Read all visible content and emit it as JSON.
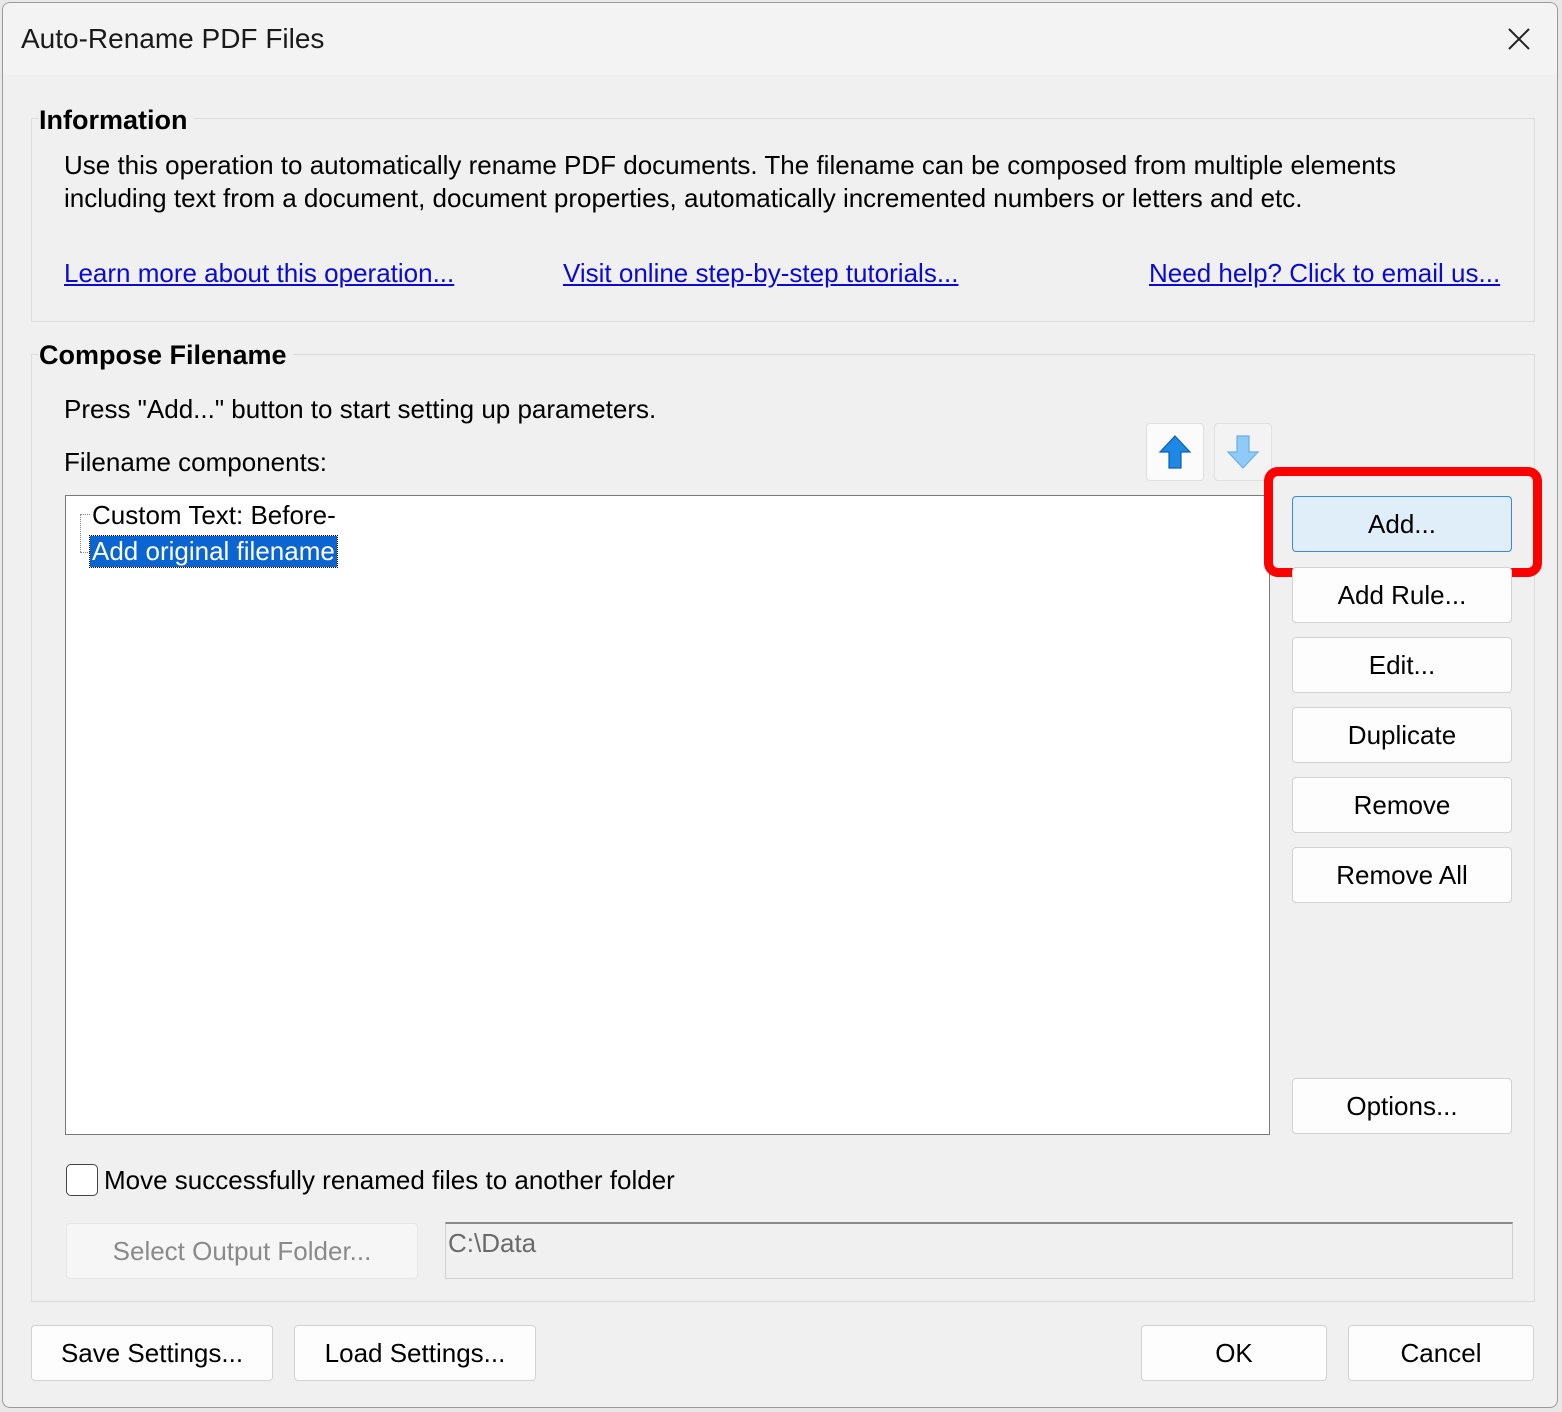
{
  "window": {
    "title": "Auto-Rename PDF Files"
  },
  "information": {
    "heading": "Information",
    "description_line1": "Use this operation to automatically rename PDF documents. The filename can be composed from multiple elements",
    "description_line2": "including text from a document, document properties, automatically incremented numbers or letters and etc.",
    "links": {
      "learn_more": "Learn more about this operation...",
      "tutorials": "Visit online step-by-step tutorials...",
      "help": "Need help? Click to email us..."
    }
  },
  "compose": {
    "heading": "Compose Filename",
    "hint": "Press \"Add...\" button to start setting up parameters.",
    "components_label": "Filename components:",
    "components": [
      {
        "label": "Custom Text: Before-",
        "selected": false
      },
      {
        "label": "Add original filename",
        "selected": true
      }
    ],
    "buttons": {
      "add": "Add...",
      "add_rule": "Add Rule...",
      "edit": "Edit...",
      "duplicate": "Duplicate",
      "remove": "Remove",
      "remove_all": "Remove All",
      "options": "Options..."
    },
    "move_checkbox": {
      "label": "Move successfully renamed files to another folder",
      "checked": false
    },
    "select_output_folder": "Select Output Folder...",
    "output_folder_value": "C:\\Data"
  },
  "footer": {
    "save_settings": "Save Settings...",
    "load_settings": "Load Settings...",
    "ok": "OK",
    "cancel": "Cancel"
  },
  "colors": {
    "link": "#0a0ad0",
    "selection": "#0a64d2",
    "highlight": "#ff0000",
    "arrow_up": "#1e88e5",
    "arrow_down_disabled": "#90caf9"
  },
  "icons": {
    "close": "close-icon",
    "move_up": "arrow-up-icon",
    "move_down": "arrow-down-icon"
  }
}
